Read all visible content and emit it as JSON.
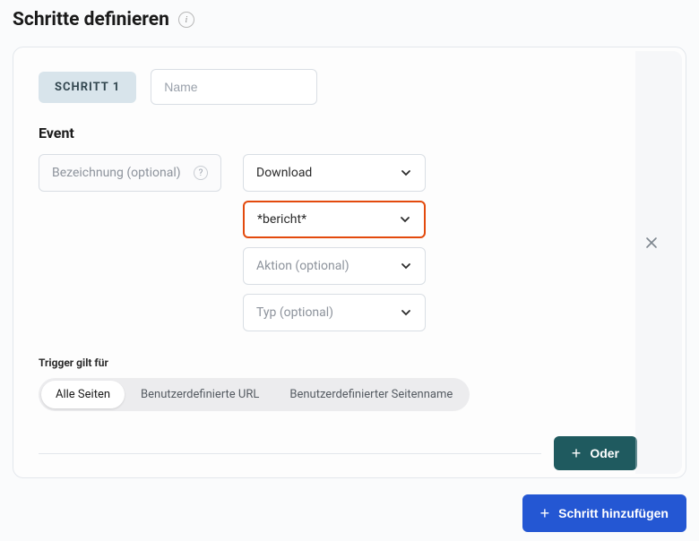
{
  "header": {
    "title": "Schritte definieren"
  },
  "step": {
    "label": "SCHRITT 1",
    "name_placeholder": "Name"
  },
  "event": {
    "section_label": "Event",
    "label_placeholder": "Bezeichnung (optional)",
    "type_value": "Download",
    "match_value": "*bericht*",
    "action_placeholder": "Aktion (optional)",
    "kind_placeholder": "Typ (optional)"
  },
  "trigger": {
    "label": "Trigger gilt für",
    "options": {
      "all": "Alle Seiten",
      "url": "Benutzerdefinierte URL",
      "pagename": "Benutzerdefinierter Seitenname"
    }
  },
  "buttons": {
    "or": "Oder",
    "add_step": "Schritt hinzufügen"
  }
}
